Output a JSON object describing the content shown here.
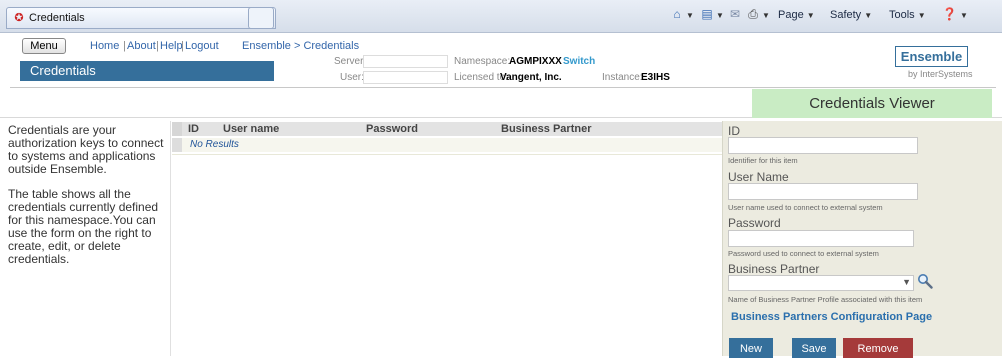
{
  "browser": {
    "tab_title": "Credentials",
    "page_menu": "Page",
    "safety_menu": "Safety",
    "tools_menu": "Tools"
  },
  "header": {
    "menu_label": "Menu",
    "links": [
      "Home",
      "About",
      "Help",
      "Logout"
    ],
    "separator": "|",
    "breadcrumb": "Ensemble > Credentials",
    "page_title": "Credentials",
    "server_label": "Server:",
    "server_value": "",
    "user_label": "User:",
    "user_value": "",
    "namespace_label": "Namespace:",
    "namespace_value": "AGMPIXXX",
    "switch_label": "Switch",
    "licensed_label": "Licensed to:",
    "licensed_value": "Vangent, Inc.",
    "instance_label": "Instance:",
    "instance_value": "E3IHS",
    "brand": "Ensemble",
    "brand_sub": "by InterSystems"
  },
  "viewer_title": "Credentials Viewer",
  "description": {
    "p1": "Credentials are your authorization keys to connect to systems and applications outside Ensemble.",
    "p2": "The table shows all the credentials currently defined for this namespace.You can use the form on the right to create, edit, or delete credentials."
  },
  "table": {
    "columns": [
      "ID",
      "User name",
      "Password",
      "Business Partner"
    ],
    "empty_text": "No Results"
  },
  "form": {
    "id_label": "ID",
    "id_hint": "Identifier for this item",
    "id_value": "",
    "username_label": "User Name",
    "username_hint": "User name used to connect to external system",
    "username_value": "",
    "password_label": "Password",
    "password_hint": "Password used to connect to external system",
    "password_value": "",
    "partner_label": "Business Partner",
    "partner_hint": "Name of Business Partner Profile associated with this item",
    "partner_value": "",
    "partner_link": "Business Partners Configuration Page",
    "new_label": "New",
    "save_label": "Save",
    "remove_label": "Remove"
  },
  "colors": {
    "title_bar": "#356f9b",
    "viewer_header": "#c9ecc4",
    "form_bg": "#ecebe0",
    "remove_button": "#a53a3a"
  }
}
